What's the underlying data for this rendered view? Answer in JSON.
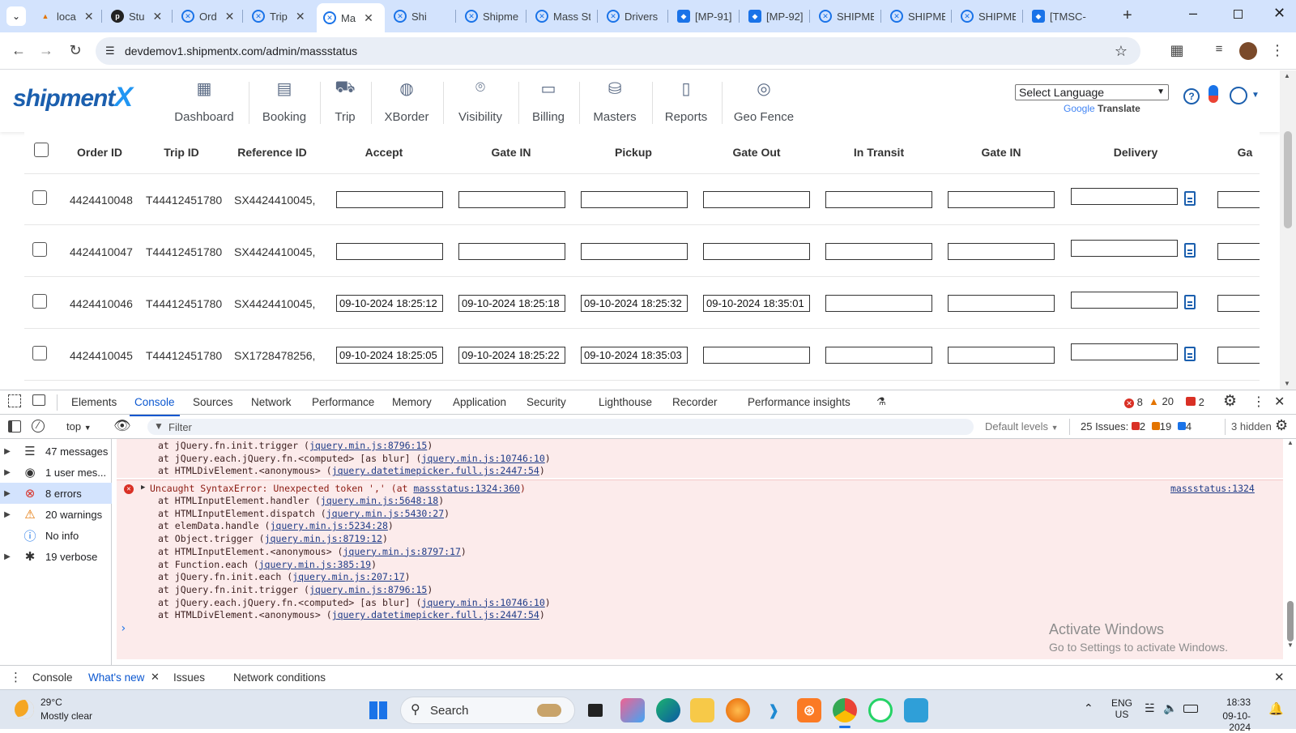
{
  "browser": {
    "tabs": [
      {
        "title": "loca",
        "icon": "flame-icon"
      },
      {
        "title": "Stu",
        "icon": "php-icon"
      },
      {
        "title": "Ord",
        "icon": "shipmentx-icon"
      },
      {
        "title": "Trip",
        "icon": "shipmentx-icon"
      },
      {
        "title": "Ma",
        "icon": "shipmentx-icon",
        "active": true
      },
      {
        "title": "Shi",
        "icon": "shipmentx-icon"
      },
      {
        "title": "Shipme",
        "icon": "shipmentx-icon"
      },
      {
        "title": "Mass St",
        "icon": "shipmentx-icon"
      },
      {
        "title": "Drivers",
        "icon": "shipmentx-icon"
      },
      {
        "title": "[MP-91]",
        "icon": "jira-icon"
      },
      {
        "title": "[MP-92]",
        "icon": "jira-icon"
      },
      {
        "title": "SHIPME",
        "icon": "shipmentx-icon"
      },
      {
        "title": "SHIPME",
        "icon": "shipmentx-icon"
      },
      {
        "title": "SHIPME",
        "icon": "shipmentx-icon"
      },
      {
        "title": "[TMSC-",
        "icon": "jira-icon"
      }
    ],
    "url": "devdemov1.shipmentx.com/admin/massstatus"
  },
  "app": {
    "logo_text": "shipment",
    "logo_x": "X",
    "nav": [
      {
        "label": "Dashboard",
        "icon": "dashboard-icon"
      },
      {
        "label": "Booking",
        "icon": "booking-icon"
      },
      {
        "label": "Trip",
        "icon": "truck-icon"
      },
      {
        "label": "XBorder",
        "icon": "globe-icon"
      },
      {
        "label": "Visibility",
        "icon": "location-pin-icon"
      },
      {
        "label": "Billing",
        "icon": "card-icon"
      },
      {
        "label": "Masters",
        "icon": "database-icon"
      },
      {
        "label": "Reports",
        "icon": "report-icon"
      },
      {
        "label": "Geo Fence",
        "icon": "geofence-icon"
      }
    ],
    "language_select": "Select Language",
    "google": "Google",
    "translate": "Translate"
  },
  "table": {
    "headers": [
      "Order ID",
      "Trip ID",
      "Reference ID",
      "Accept",
      "Gate IN",
      "Pickup",
      "Gate Out",
      "In Transit",
      "Gate IN",
      "Delivery",
      "Ga"
    ],
    "rows": [
      {
        "order": "4424410048",
        "trip": "T44412451780",
        "ref": "SX4424410045,",
        "dates": [
          "",
          "",
          "",
          "",
          "",
          "",
          ""
        ]
      },
      {
        "order": "4424410047",
        "trip": "T44412451780",
        "ref": "SX4424410045,",
        "dates": [
          "",
          "",
          "",
          "",
          "",
          "",
          ""
        ]
      },
      {
        "order": "4424410046",
        "trip": "T44412451780",
        "ref": "SX4424410045,",
        "dates": [
          "09-10-2024 18:25:12",
          "09-10-2024 18:25:18",
          "09-10-2024 18:25:32",
          "09-10-2024 18:35:01",
          "",
          "",
          ""
        ]
      },
      {
        "order": "4424410045",
        "trip": "T44412451780",
        "ref": "SX1728478256,",
        "dates": [
          "09-10-2024 18:25:05",
          "09-10-2024 18:25:22",
          "09-10-2024 18:35:03",
          "",
          "",
          "",
          ""
        ]
      }
    ]
  },
  "devtools": {
    "tabs": [
      "Elements",
      "Console",
      "Sources",
      "Network",
      "Performance",
      "Memory",
      "Application",
      "Security",
      "Lighthouse",
      "Recorder",
      "Performance insights"
    ],
    "active_tab": "Console",
    "counts": {
      "errors": "8",
      "warnings": "20",
      "issues_badge": "2"
    },
    "context": "top",
    "filter_placeholder": "Filter",
    "levels": "Default levels",
    "issues": {
      "label": "25 Issues:",
      "errors": "2",
      "warnings": "19",
      "info": "4",
      "hidden": "3 hidden"
    },
    "sidebar": [
      {
        "label": "47 messages",
        "icon": "list-icon",
        "arrow": true
      },
      {
        "label": "1 user mes...",
        "icon": "user-icon",
        "arrow": true
      },
      {
        "label": "8 errors",
        "icon": "error-icon",
        "arrow": true,
        "selected": true
      },
      {
        "label": "20 warnings",
        "icon": "warning-icon",
        "arrow": true
      },
      {
        "label": "No info",
        "icon": "info-icon",
        "arrow": false
      },
      {
        "label": "19 verbose",
        "icon": "bug-icon",
        "arrow": true
      }
    ],
    "prev_trace": [
      {
        "text": "at jQuery.fn.init.trigger (",
        "link": "jquery.min.js:8796:15",
        "tail": ")"
      },
      {
        "text": "at jQuery.each.jQuery.fn.<computed> [as blur] (",
        "link": "jquery.min.js:10746:10",
        "tail": ")"
      },
      {
        "text": "at HTMLDivElement.<anonymous> (",
        "link": "jquery.datetimepicker.full.js:2447:54",
        "tail": ")"
      }
    ],
    "error": {
      "message": "Uncaught SyntaxError: Unexpected token ',' (at ",
      "message_link": "massstatus:1324:360",
      "message_tail": ")",
      "source": "massstatus:1324",
      "trace": [
        {
          "text": "at HTMLInputElement.handler (",
          "link": "jquery.min.js:5648:18",
          "tail": ")"
        },
        {
          "text": "at HTMLInputElement.dispatch (",
          "link": "jquery.min.js:5430:27",
          "tail": ")"
        },
        {
          "text": "at elemData.handle (",
          "link": "jquery.min.js:5234:28",
          "tail": ")"
        },
        {
          "text": "at Object.trigger (",
          "link": "jquery.min.js:8719:12",
          "tail": ")"
        },
        {
          "text": "at HTMLInputElement.<anonymous> (",
          "link": "jquery.min.js:8797:17",
          "tail": ")"
        },
        {
          "text": "at Function.each (",
          "link": "jquery.min.js:385:19",
          "tail": ")"
        },
        {
          "text": "at jQuery.fn.init.each (",
          "link": "jquery.min.js:207:17",
          "tail": ")"
        },
        {
          "text": "at jQuery.fn.init.trigger (",
          "link": "jquery.min.js:8796:15",
          "tail": ")"
        },
        {
          "text": "at jQuery.each.jQuery.fn.<computed> [as blur] (",
          "link": "jquery.min.js:10746:10",
          "tail": ")"
        },
        {
          "text": "at HTMLDivElement.<anonymous> (",
          "link": "jquery.datetimepicker.full.js:2447:54",
          "tail": ")"
        }
      ]
    },
    "prompt": "›",
    "drawer_tabs": [
      "Console",
      "What's new",
      "Issues",
      "Network conditions"
    ],
    "drawer_active": "What's new"
  },
  "watermark": {
    "line1": "Activate Windows",
    "line2": "Go to Settings to activate Windows."
  },
  "taskbar": {
    "temp": "29°C",
    "weather": "Mostly clear",
    "search": "Search",
    "lang1": "ENG",
    "lang2": "US",
    "time": "18:33",
    "date": "09-10-2024"
  },
  "colors": {
    "brand": "#1b5fae",
    "devtools_active": "#0b57d0",
    "error_bg": "#fcebeb",
    "tabstrip": "#d3e3fd"
  }
}
